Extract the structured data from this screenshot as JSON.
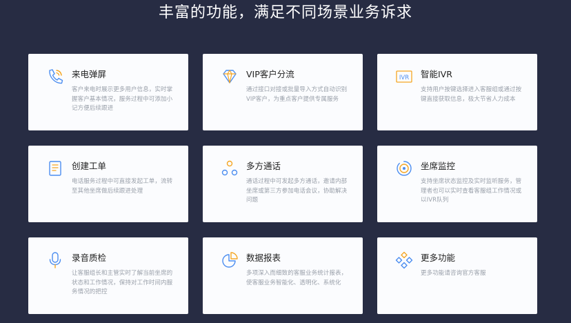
{
  "page_title": "丰富的功能，满足不同场景业务诉求",
  "colors": {
    "background": "#272c43",
    "card": "#fbfcfe",
    "icon_blue": "#4b8df0",
    "icon_orange": "#f5a623"
  },
  "features": [
    {
      "icon": "phone-icon",
      "title": "来电弹屏",
      "desc": "客户来电时展示更多用户信息，实时掌握客户基本情况，服务过程中可添加小记方便后续跟进"
    },
    {
      "icon": "diamond-icon",
      "title": "VIP客户分流",
      "desc": "通过接口对接或批量导入方式自动识别VIP客户，为重点客户提供专属服务"
    },
    {
      "icon": "ivr-icon",
      "title": "智能IVR",
      "desc": "支持用户按键选择进入客服组或通过按键直接获取信息，极大节省人力成本"
    },
    {
      "icon": "document-icon",
      "title": "创建工单",
      "desc": "电话服务过程中可直接发起工单，流转至其他坐席做后续跟进处理"
    },
    {
      "icon": "multi-party-icon",
      "title": "多方通话",
      "desc": "通话过程中可发起多方通话，邀请内部坐席或第三方参加电话会议，协助解决问题"
    },
    {
      "icon": "monitor-icon",
      "title": "坐席监控",
      "desc": "支持坐席状态监控及实时监听服务，管理者也可以实时查看客服组工作情况或以IVR队列"
    },
    {
      "icon": "microphone-icon",
      "title": "录音质检",
      "desc": "让客服组长和主管实时了解当前坐席的状态和工作情况，保持对工作时间内服务情况的把控"
    },
    {
      "icon": "pie-chart-icon",
      "title": "数据报表",
      "desc": "多项深入而细致的客服业务统计报表，使客服业务智能化、透明化、系统化"
    },
    {
      "icon": "more-features-icon",
      "title": "更多功能",
      "desc": "更多功能请咨询官方客服"
    }
  ]
}
